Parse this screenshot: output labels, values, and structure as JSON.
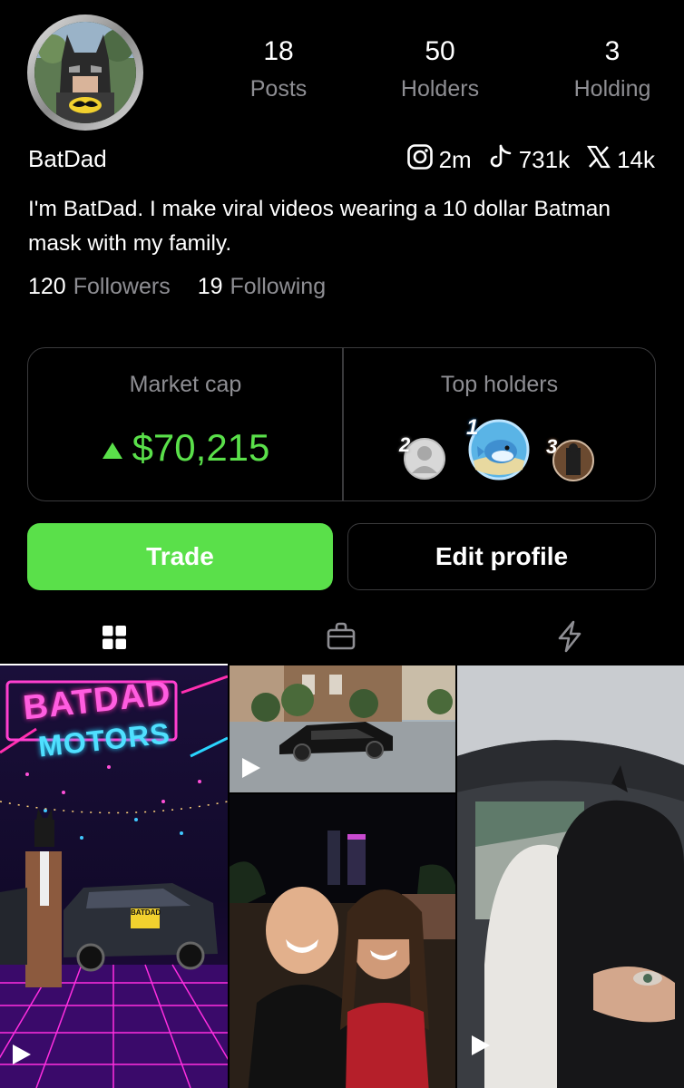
{
  "profile": {
    "name": "BatDad",
    "bio": "I'm BatDad. I make viral videos wearing a 10 dollar Batman mask with my family."
  },
  "stats": [
    {
      "value": "18",
      "label": "Posts"
    },
    {
      "value": "50",
      "label": "Holders"
    },
    {
      "value": "3",
      "label": "Holding"
    }
  ],
  "socials": {
    "instagram": {
      "icon": "instagram-icon",
      "count": "2m"
    },
    "tiktok": {
      "icon": "tiktok-icon",
      "count": "731k"
    },
    "x": {
      "icon": "x-icon",
      "count": "14k"
    }
  },
  "follow": {
    "followers_count": "120",
    "followers_label": "Followers",
    "following_count": "19",
    "following_label": "Following"
  },
  "market": {
    "label": "Market cap",
    "value": "$70,215",
    "trend_icon": "triangle-up-icon",
    "color": "#5ae04a"
  },
  "top_holders": {
    "label": "Top holders",
    "ranks": [
      "2",
      "1",
      "3"
    ]
  },
  "buttons": {
    "trade": "Trade",
    "edit": "Edit profile"
  },
  "tabs": [
    {
      "icon": "grid-icon",
      "active": true
    },
    {
      "icon": "shopping-bag-icon",
      "active": false
    },
    {
      "icon": "lightning-icon",
      "active": false
    }
  ],
  "grid": {
    "tile1": {
      "sign_line1": "BATDAD",
      "sign_line2": "MOTORS",
      "car_badge": "BATDAD"
    }
  },
  "colors": {
    "background": "#000000",
    "accent": "#5ae04a",
    "muted": "#8e8e93",
    "border": "#3a3a3c"
  }
}
